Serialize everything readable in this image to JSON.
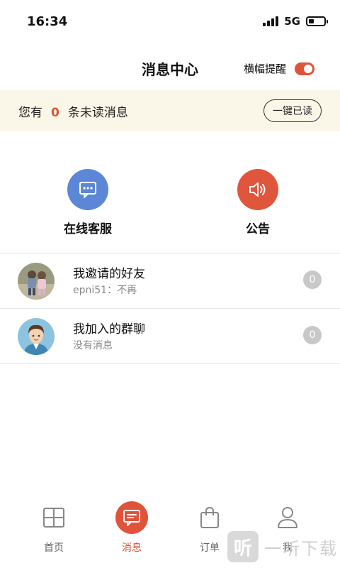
{
  "status_bar": {
    "time": "16:34",
    "network": "5G"
  },
  "header": {
    "title": "消息中心",
    "banner_alert_label": "横幅提醒",
    "banner_alert_on": true
  },
  "unread": {
    "prefix": "您有",
    "count": "0",
    "suffix": "条未读消息",
    "mark_all_read_label": "一键已读"
  },
  "quick_actions": [
    {
      "label": "在线客服",
      "icon": "chat-bubble-icon",
      "color": "#5b87d6"
    },
    {
      "label": "公告",
      "icon": "speaker-icon",
      "color": "#e0563d"
    }
  ],
  "conversations": [
    {
      "title": "我邀请的好友",
      "subtitle": "epni51：不再",
      "count": "0"
    },
    {
      "title": "我加入的群聊",
      "subtitle": "没有消息",
      "count": "0"
    }
  ],
  "bottom_nav": [
    {
      "label": "首页",
      "icon": "home-grid-icon",
      "active": false
    },
    {
      "label": "消息",
      "icon": "message-icon",
      "active": true
    },
    {
      "label": "订单",
      "icon": "shopping-bag-icon",
      "active": false
    },
    {
      "label": "我",
      "icon": "profile-icon",
      "active": false
    }
  ],
  "watermark": {
    "badge": "听",
    "text": "一听下载"
  },
  "colors": {
    "accent": "#e0533b",
    "strip_bg": "#faf6e8"
  }
}
